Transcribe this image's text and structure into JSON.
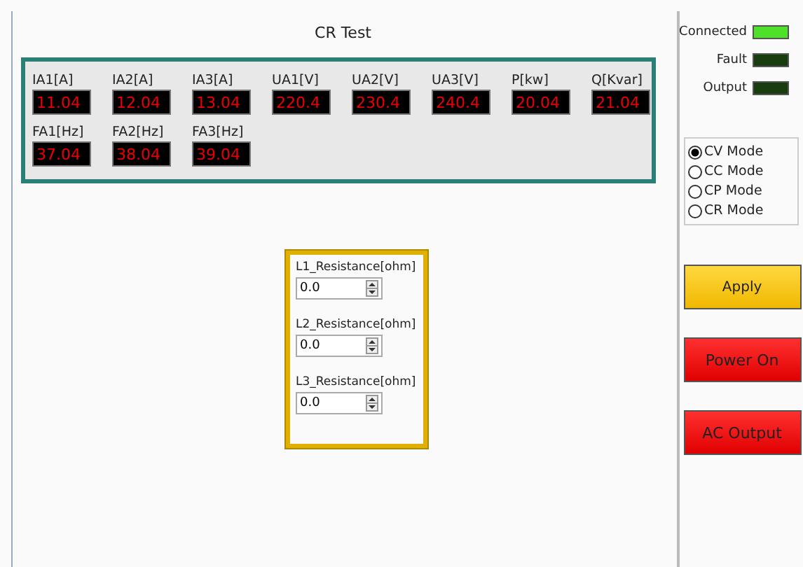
{
  "window": {
    "title": "CR Test"
  },
  "meters": [
    {
      "label": "IA1[A]",
      "value": "11.04"
    },
    {
      "label": "IA2[A]",
      "value": "12.04"
    },
    {
      "label": "IA3[A]",
      "value": "13.04"
    },
    {
      "label": "UA1[V]",
      "value": "220.4"
    },
    {
      "label": "UA2[V]",
      "value": "230.4"
    },
    {
      "label": "UA3[V]",
      "value": "240.4"
    },
    {
      "label": "P[kw]",
      "value": "20.04"
    },
    {
      "label": "Q[Kvar]",
      "value": "21.04"
    },
    {
      "label": "FA1[Hz]",
      "value": "37.04"
    },
    {
      "label": "FA2[Hz]",
      "value": "38.04"
    },
    {
      "label": "FA3[Hz]",
      "value": "39.04"
    }
  ],
  "resistances": [
    {
      "label": "L1_Resistance[ohm]",
      "value": "0.0"
    },
    {
      "label": "L2_Resistance[ohm]",
      "value": "0.0"
    },
    {
      "label": "L3_Resistance[ohm]",
      "value": "0.0"
    }
  ],
  "indicators": [
    {
      "label": "Connected",
      "on": true
    },
    {
      "label": "Fault",
      "on": false
    },
    {
      "label": "Output",
      "on": false
    }
  ],
  "modes": [
    {
      "label": "CV Mode",
      "selected": true
    },
    {
      "label": "CC Mode",
      "selected": false
    },
    {
      "label": "CP Mode",
      "selected": false
    },
    {
      "label": "CR Mode",
      "selected": false
    }
  ],
  "buttons": [
    {
      "label": "Apply",
      "kind": "warning"
    },
    {
      "label": "Power On",
      "kind": "danger"
    },
    {
      "label": "AC Output",
      "kind": "danger"
    }
  ]
}
